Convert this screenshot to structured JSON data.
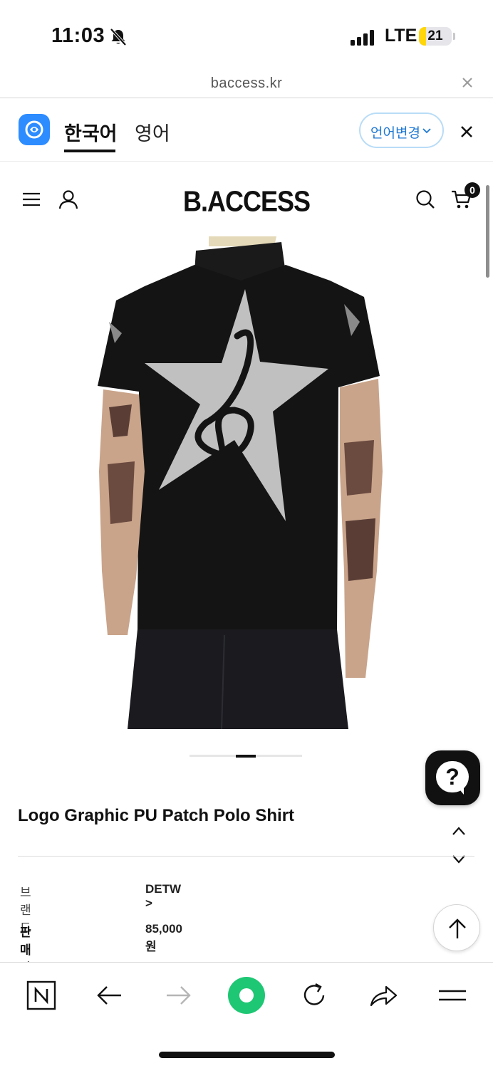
{
  "status_bar": {
    "time": "11:03",
    "network": "LTE",
    "battery_percent": "21",
    "battery_level": 0.21,
    "silent_mode": true
  },
  "browser": {
    "url": "baccess.kr"
  },
  "translate_bar": {
    "source_language": "한국어",
    "target_language": "영어",
    "change_language_label": "언어변경",
    "accent_color": "#2d8cff"
  },
  "header": {
    "logo": "B.ACCESS",
    "cart_count": "0"
  },
  "product": {
    "title": "Logo Graphic PU Patch Polo Shirt",
    "image_index": 2,
    "image_count": 3,
    "brand_label": "브랜드",
    "brand_value": "DETW >",
    "price_label": "판매가",
    "price_value": "85,000원"
  },
  "help_button": {
    "label": "?"
  }
}
